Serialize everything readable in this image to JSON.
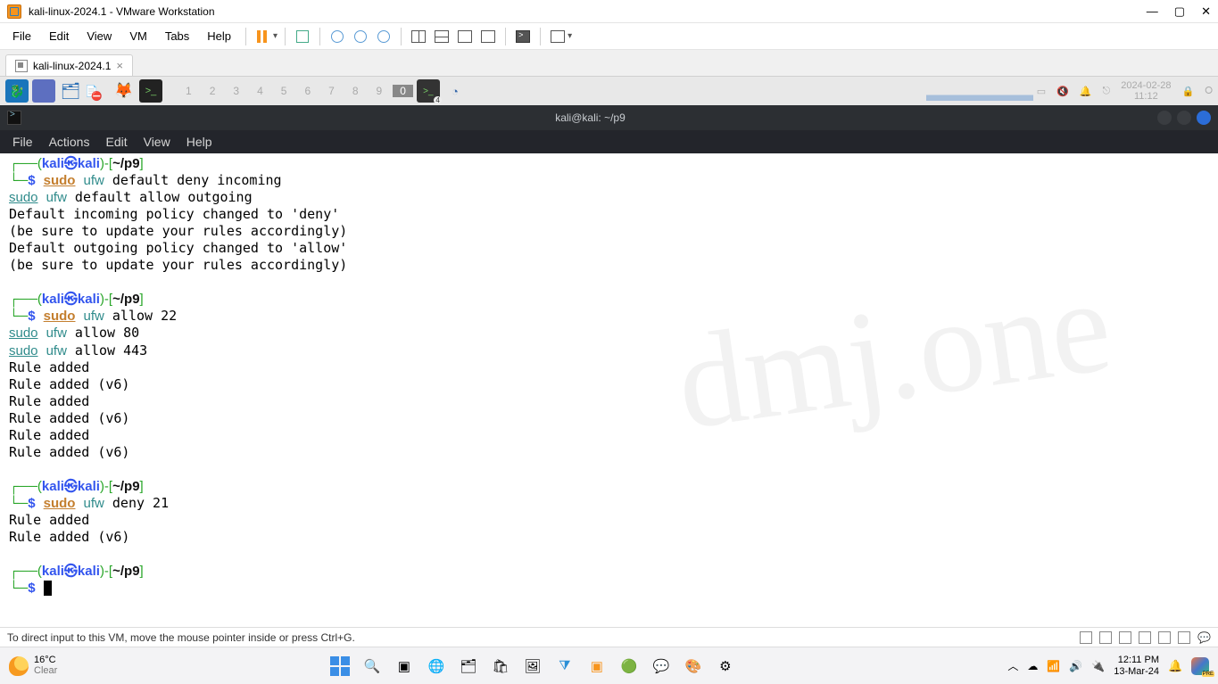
{
  "vmware": {
    "title": "kali-linux-2024.1 - VMware Workstation",
    "menu": [
      "File",
      "Edit",
      "View",
      "VM",
      "Tabs",
      "Help"
    ],
    "tab_label": "kali-linux-2024.1",
    "status_hint": "To direct input to this VM, move the mouse pointer inside or press Ctrl+G."
  },
  "kali_panel": {
    "workspaces": [
      "1",
      "2",
      "3",
      "4",
      "5",
      "6",
      "7",
      "8",
      "9",
      "0"
    ],
    "active_ws": "0",
    "date_top": "2024-02-28",
    "date_bottom": "11:12"
  },
  "terminal": {
    "window_title": "kali@kali: ~/p9",
    "menu": [
      "File",
      "Actions",
      "Edit",
      "View",
      "Help"
    ],
    "prompt_user": "kali",
    "prompt_host": "kali",
    "prompt_path": "~/p9",
    "blocks": [
      {
        "cmd": "sudo ufw default deny incoming",
        "extra_lines": [
          {
            "sudo": true,
            "ufw": true,
            "rest": " default allow outgoing"
          }
        ],
        "output": [
          "Default incoming policy changed to 'deny'",
          "(be sure to update your rules accordingly)",
          "Default outgoing policy changed to 'allow'",
          "(be sure to update your rules accordingly)"
        ]
      },
      {
        "cmd": "sudo ufw allow 22",
        "extra_lines": [
          {
            "sudo": true,
            "ufw": true,
            "rest": " allow 80"
          },
          {
            "sudo": true,
            "ufw": true,
            "rest": " allow 443"
          }
        ],
        "output": [
          "Rule added",
          "Rule added (v6)",
          "Rule added",
          "Rule added (v6)",
          "Rule added",
          "Rule added (v6)"
        ]
      },
      {
        "cmd": "sudo ufw deny 21",
        "extra_lines": [],
        "output": [
          "Rule added",
          "Rule added (v6)"
        ]
      }
    ],
    "watermark": "dmj.one"
  },
  "windows_taskbar": {
    "temp": "16°C",
    "cond": "Clear",
    "time": "12:11 PM",
    "date": "13-Mar-24"
  }
}
